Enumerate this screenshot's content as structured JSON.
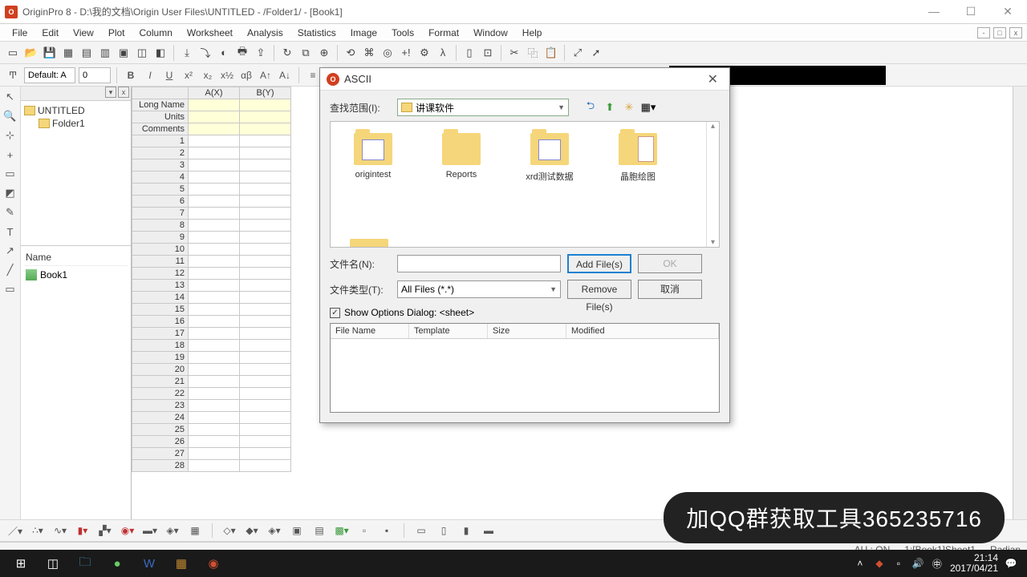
{
  "window": {
    "title": "OriginPro 8 - D:\\我的文档\\Origin User Files\\UNTITLED - /Folder1/ - [Book1]"
  },
  "menu": {
    "items": [
      "File",
      "Edit",
      "View",
      "Plot",
      "Column",
      "Worksheet",
      "Analysis",
      "Statistics",
      "Image",
      "Tools",
      "Format",
      "Window",
      "Help"
    ]
  },
  "format_bar": {
    "font": "Default: A",
    "size": "0"
  },
  "project": {
    "root": "UNTITLED",
    "folder": "Folder1",
    "name_header": "Name",
    "book": "Book1"
  },
  "worksheet": {
    "cols": [
      "A(X)",
      "B(Y)"
    ],
    "meta_rows": [
      "Long Name",
      "Units",
      "Comments"
    ],
    "sheet_tab": "Sheet1"
  },
  "dialog": {
    "title": "ASCII",
    "look_in_label": "查找范围(I):",
    "look_in_value": "讲课软件",
    "folders": [
      "origintest",
      "Reports",
      "xrd测试数据",
      "晶胞绘图"
    ],
    "filename_label": "文件名(N):",
    "filename_value": "",
    "filetype_label": "文件类型(T):",
    "filetype_value": "All Files (*.*)",
    "btn_addfiles": "Add File(s)",
    "btn_ok": "OK",
    "btn_removefiles": "Remove File(s)",
    "btn_cancel": "取消",
    "show_options": "Show Options Dialog: <sheet>",
    "list_cols": {
      "c1": "File Name",
      "c2": "Template",
      "c3": "Size",
      "c4": "Modified"
    }
  },
  "status": {
    "au": "AU : ON",
    "loc": "1:[Book1]Sheet1",
    "unit": "Radian"
  },
  "watermark": "加QQ群获取工具365235716",
  "tray": {
    "time": "21:14",
    "date": "2017/04/21"
  }
}
